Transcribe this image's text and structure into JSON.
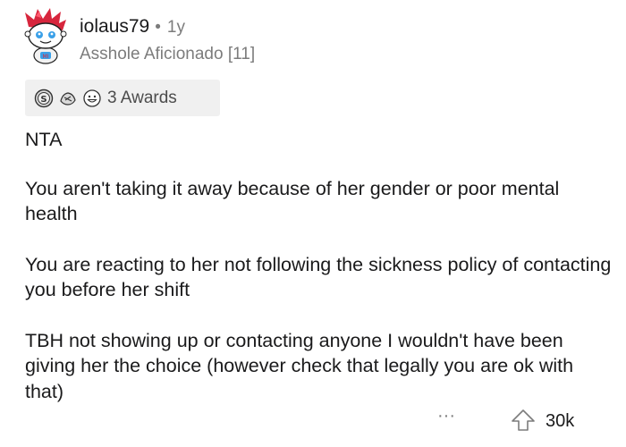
{
  "comment": {
    "author": "iolaus79",
    "separator": "•",
    "age": "1y",
    "flair": "Asshole Aficionado [11]",
    "awards": {
      "icons": [
        "silver-award-icon",
        "wholesome-hands-award-icon",
        "grinning-face-award-icon"
      ],
      "count_label": "3 Awards"
    },
    "paragraphs": [
      "NTA",
      "You aren't taking it away because of her gender or poor mental health",
      "You are reacting to her not following the sickness policy of contacting you before her shift",
      "TBH not showing up or contacting anyone I wouldn't have been giving her the choice (however check that legally you are ok with that)"
    ],
    "actions": {
      "more_label": "···",
      "score": "30k"
    }
  },
  "colors": {
    "text_primary": "#1a1a1b",
    "text_meta": "#7c7c7c",
    "award_bar_bg": "#f0f0f0",
    "avatar_red": "#d7263d",
    "avatar_blue": "#3aa0e8"
  }
}
